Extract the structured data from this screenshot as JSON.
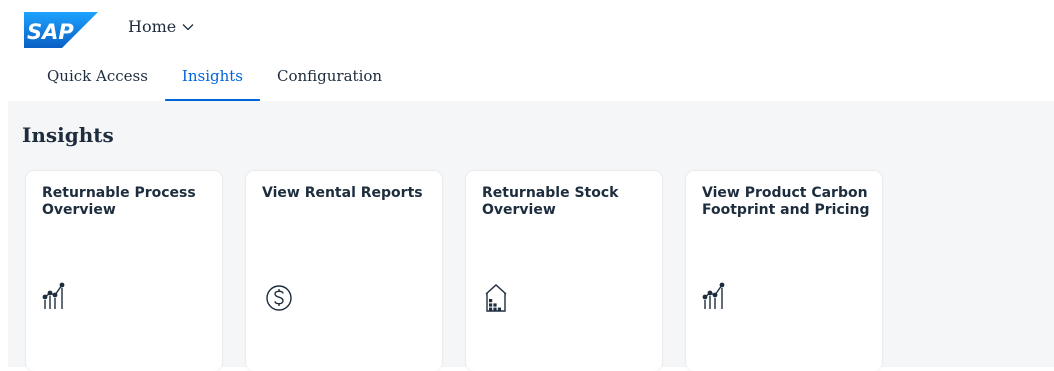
{
  "header": {
    "logo_text": "SAP",
    "home_label": "Home",
    "home_icon": "chevron-down-icon"
  },
  "tabs": [
    {
      "label": "Quick Access",
      "selected": false
    },
    {
      "label": "Insights",
      "selected": true
    },
    {
      "label": "Configuration",
      "selected": false
    }
  ],
  "section": {
    "title": "Insights"
  },
  "cards": [
    {
      "title": "Returnable Process Overview",
      "icon": "line-chart-icon"
    },
    {
      "title": "View Rental Reports",
      "icon": "dollar-circle-icon"
    },
    {
      "title": "Returnable Stock Overview",
      "icon": "warehouse-icon"
    },
    {
      "title": "View Product Carbon Footprint and Pricing",
      "icon": "line-chart-icon"
    }
  ],
  "colors": {
    "brand_blue": "#0a6ed1",
    "accent": "#0064d9",
    "text": "#1d2d3e",
    "background": "#f5f6f7"
  }
}
